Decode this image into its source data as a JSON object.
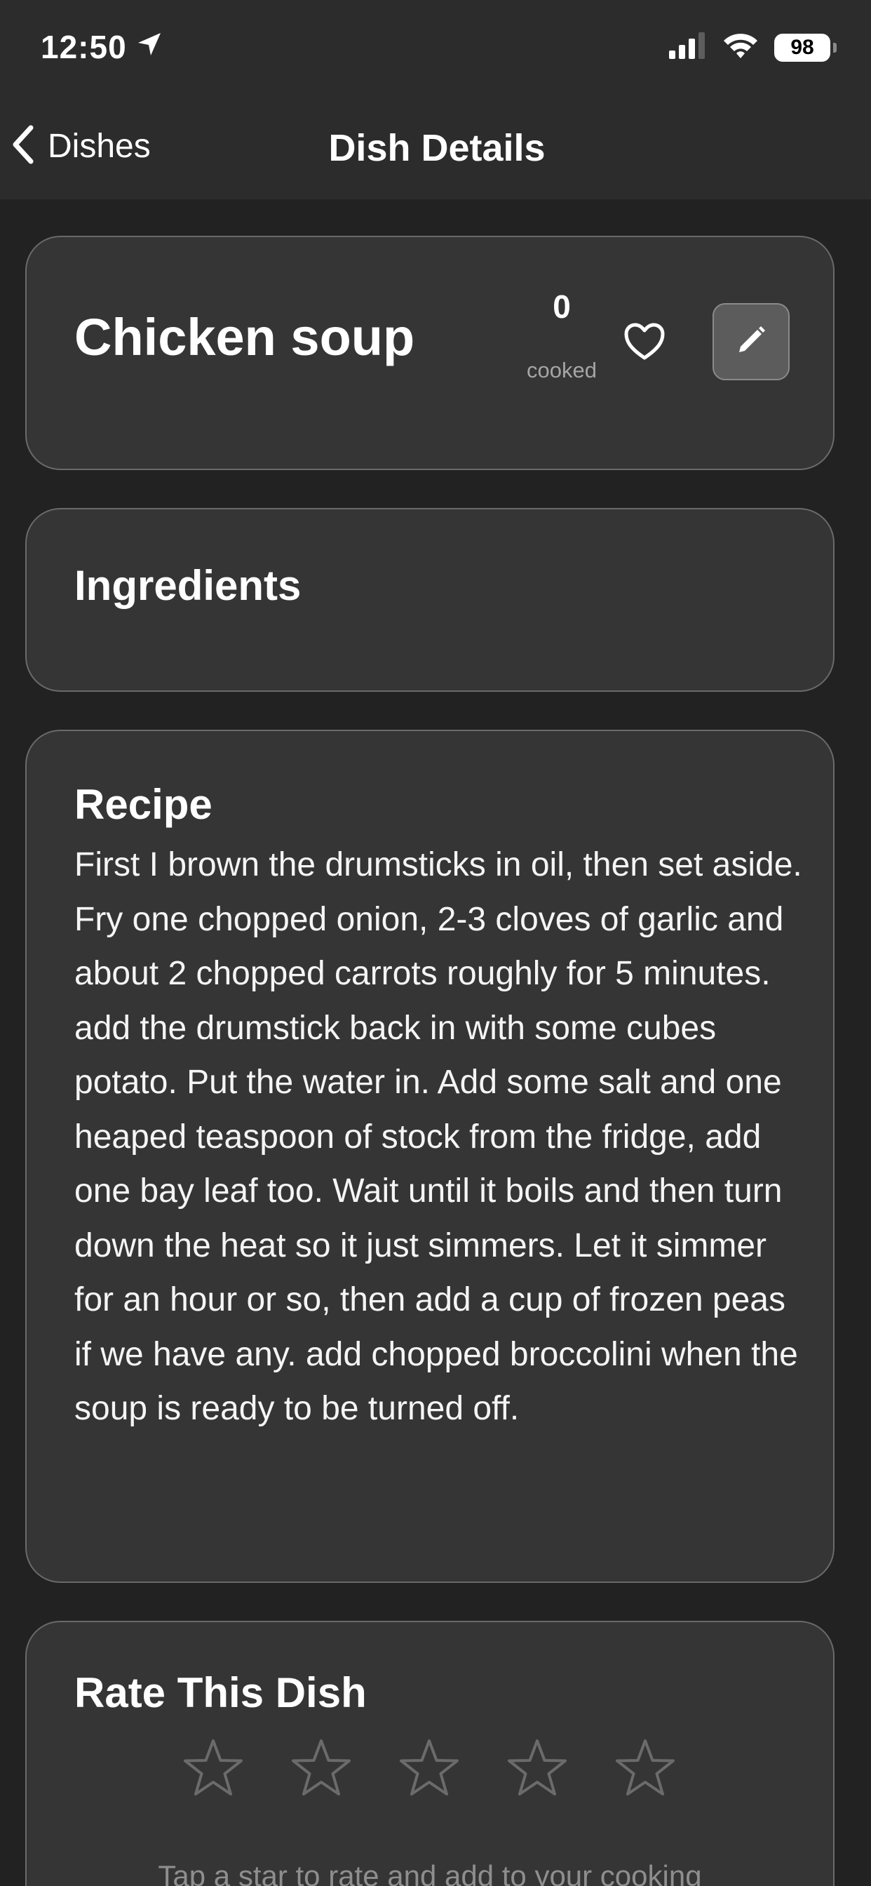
{
  "status_bar": {
    "time": "12:50",
    "battery": "98",
    "icons": [
      "location-arrow-icon",
      "signal-bars-icon",
      "wifi-icon",
      "battery-icon"
    ]
  },
  "nav": {
    "back_label": "Dishes",
    "title": "Dish Details"
  },
  "dish": {
    "name": "Chicken soup",
    "cooked_count": "0",
    "cooked_label": "cooked",
    "favorite_icon": "heart-outline-icon",
    "edit_icon": "pencil-icon"
  },
  "ingredients": {
    "title": "Ingredients"
  },
  "recipe": {
    "title": "Recipe",
    "text": "First I brown the drumsticks in oil, then set aside.\nFry one chopped onion, 2-3 cloves of garlic and about 2 chopped carrots roughly for 5 minutes. add the drumstick back in with some cubes potato. Put the water in. Add some salt and one heaped teaspoon of stock from the fridge, add one bay leaf too. Wait until it boils and then turn down the heat so it just simmers. Let it simmer for an hour or so, then add a cup of frozen peas if we have any. add chopped broccolini when the soup is ready to be turned off."
  },
  "rating": {
    "title": "Rate This Dish",
    "stars": 0,
    "max_stars": 5,
    "hint": "Tap a star to rate and add to your cooking"
  },
  "colors": {
    "background": "#222222",
    "nav_background": "#2c2c2c",
    "card_background": "#353535",
    "card_border": "#6a6a6a",
    "muted_text": "#a5a5a5",
    "star_outline": "#6b6b6b"
  }
}
